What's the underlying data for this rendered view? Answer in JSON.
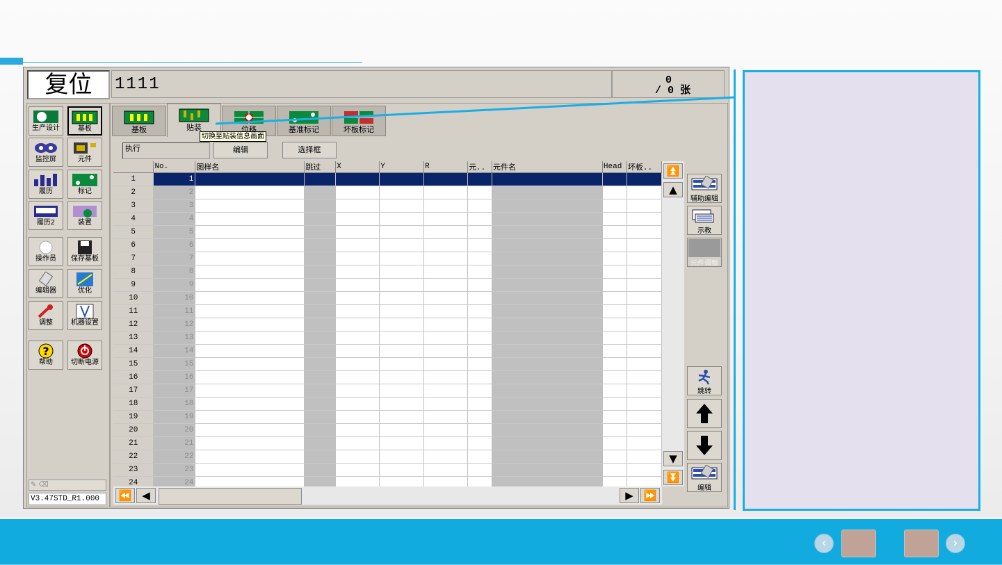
{
  "status": {
    "mode": "复位",
    "work_order": "1111",
    "count_current": "0",
    "count_total": "/ 0 张"
  },
  "sidebar": {
    "items": [
      {
        "label": "生产设计",
        "icon": "production-design-icon"
      },
      {
        "label": "基板",
        "icon": "board-icon"
      },
      {
        "label": "监控屏",
        "icon": "monitor-icon"
      },
      {
        "label": "元件",
        "icon": "component-icon"
      },
      {
        "label": "履历",
        "icon": "history-icon"
      },
      {
        "label": "标记",
        "icon": "mark-icon"
      },
      {
        "label": "履历2",
        "icon": "history2-icon"
      },
      {
        "label": "装置",
        "icon": "device-icon"
      },
      {
        "label": "操作员",
        "icon": "operator-icon"
      },
      {
        "label": "保存基板",
        "icon": "save-disk-icon"
      },
      {
        "label": "编辑器",
        "icon": "eraser-icon"
      },
      {
        "label": "优化",
        "icon": "optimize-icon"
      },
      {
        "label": "调整",
        "icon": "wrench-icon"
      },
      {
        "label": "机器设置",
        "icon": "machine-settings-icon"
      },
      {
        "label": "帮助",
        "icon": "help-icon"
      },
      {
        "label": "切断电源",
        "icon": "power-icon"
      }
    ],
    "version": "V3.47STD_R1.000"
  },
  "tabs": [
    {
      "label": "基板"
    },
    {
      "label": "贴装"
    },
    {
      "label": "位移"
    },
    {
      "label": "基准标记"
    },
    {
      "label": "坏板标记"
    }
  ],
  "tooltip": "切换至贴装信息画面",
  "toolbar": {
    "exec_label": "执行",
    "edit_label": "编辑",
    "select_label": "选择框"
  },
  "table": {
    "columns": [
      "No.",
      "图样名",
      "跳过",
      "X",
      "Y",
      "R",
      "元..",
      "元件名",
      "Head",
      "坏板.."
    ],
    "rows": [
      "1",
      "2",
      "3",
      "4",
      "5",
      "6",
      "7",
      "8",
      "9",
      "10",
      "11",
      "12",
      "13",
      "14",
      "15",
      "16",
      "17",
      "18",
      "19",
      "20",
      "21",
      "22",
      "23",
      "24"
    ],
    "selected_row": "1"
  },
  "right_buttons": {
    "aux_edit": "辅助编辑",
    "teach": "示教",
    "component_adjust": "元件调整",
    "jump": "跳转",
    "edit": "编辑"
  },
  "footer": {
    "prev": "‹",
    "next": "›"
  },
  "colors": {
    "accent": "#12abe0",
    "selection": "#0a246a",
    "callout_bg": "#e4e0ee"
  }
}
